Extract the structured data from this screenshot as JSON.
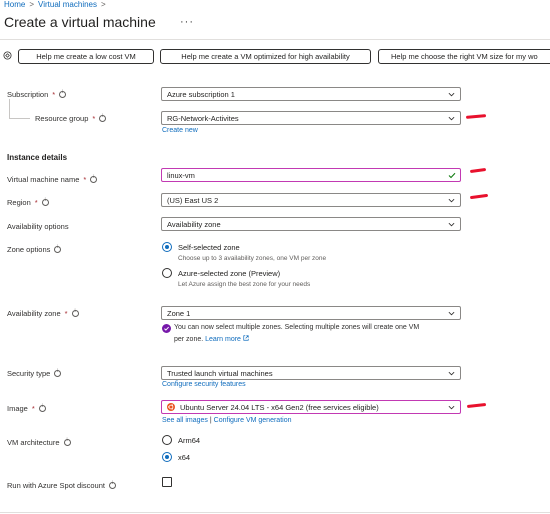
{
  "breadcrumb": {
    "home": "Home",
    "sep1": ">",
    "vm": "Virtual machines",
    "sep2": ">"
  },
  "page": {
    "title": "Create a virtual machine",
    "more": "···"
  },
  "helpers": {
    "low_cost": "Help me create a low cost VM",
    "high_availability": "Help me create a VM optimized for high availability",
    "right_size": "Help me choose the right VM size for my wo"
  },
  "form": {
    "subscription": {
      "label": "Subscription",
      "required": "*",
      "value": "Azure subscription 1"
    },
    "resource_group": {
      "label": "Resource group",
      "required": "*",
      "value": "RG-Network-Activites",
      "create_new": "Create new"
    },
    "instance_details": "Instance details",
    "vm_name": {
      "label": "Virtual machine name",
      "required": "*",
      "value": "linux-vm"
    },
    "region": {
      "label": "Region",
      "required": "*",
      "value": "(US) East US 2"
    },
    "availability_options": {
      "label": "Availability options",
      "value": "Availability zone"
    },
    "zone_options": {
      "label": "Zone options",
      "self": {
        "label": "Self-selected zone",
        "desc": "Choose up to 3 availability zones, one VM per zone",
        "selected": true
      },
      "azure": {
        "label": "Azure-selected zone (Preview)",
        "desc": "Let Azure assign the best zone for your needs",
        "selected": false
      }
    },
    "availability_zone": {
      "label": "Availability zone",
      "required": "*",
      "value": "Zone 1",
      "note": "You can now select multiple zones. Selecting multiple zones will create one VM",
      "note2": "per zone.",
      "learn_more": "Learn more"
    },
    "security_type": {
      "label": "Security type",
      "value": "Trusted launch virtual machines",
      "configure": "Configure security features"
    },
    "image": {
      "label": "Image",
      "required": "*",
      "value": "Ubuntu Server 24.04 LTS - x64 Gen2 (free services eligible)",
      "see_all": "See all images",
      "divider": "|",
      "configure_gen": "Configure VM generation"
    },
    "vm_architecture": {
      "label": "VM architecture",
      "arm64": {
        "label": "Arm64",
        "selected": false
      },
      "x64": {
        "label": "x64",
        "selected": true
      }
    },
    "spot": {
      "label": "Run with Azure Spot discount",
      "checked": false
    }
  },
  "colors": {
    "accent": "#0f6cbd",
    "required": "#a4262c",
    "annotation": "#e8112d",
    "ubuntu": "#e95420",
    "success": "#107c10",
    "info_badge": "#7719aa"
  }
}
